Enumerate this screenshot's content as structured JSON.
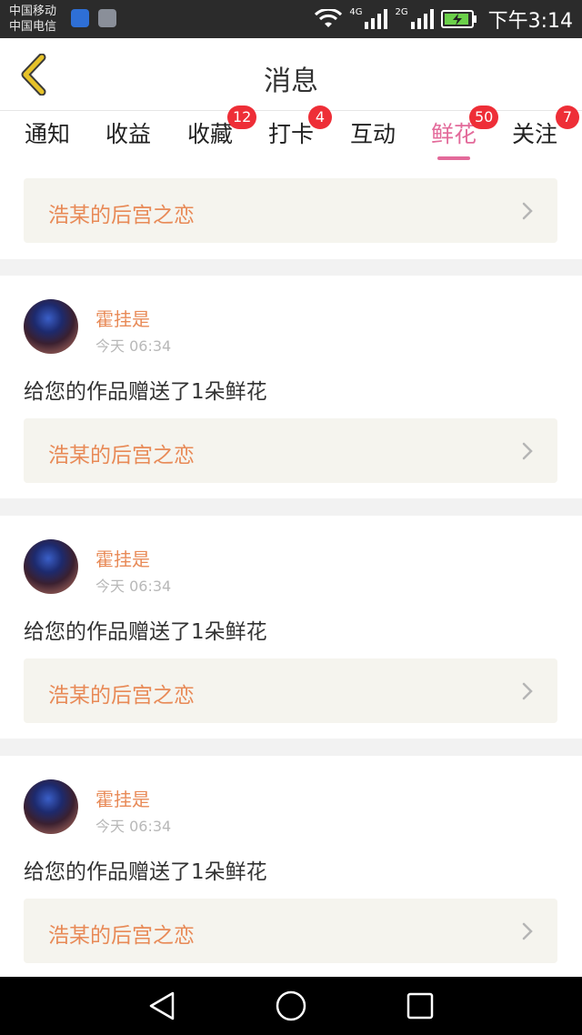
{
  "status_bar": {
    "carrier_1": "中国移动",
    "carrier_2": "中国电信",
    "net_1": "4G",
    "net_2": "2G",
    "time": "下午3:14"
  },
  "header": {
    "title": "消息"
  },
  "tabs": [
    {
      "label": "通知",
      "badge": ""
    },
    {
      "label": "收益",
      "badge": ""
    },
    {
      "label": "收藏",
      "badge": "12"
    },
    {
      "label": "打卡",
      "badge": "4"
    },
    {
      "label": "互动",
      "badge": ""
    },
    {
      "label": "鲜花",
      "badge": "50",
      "active": true
    },
    {
      "label": "关注",
      "badge": "7"
    }
  ],
  "top_partial_card": {
    "work_title": "浩某的后宫之恋"
  },
  "cards": [
    {
      "user": "霍挂是",
      "time": "今天 06:34",
      "message": "给您的作品赠送了1朵鲜花",
      "work_title": "浩某的后宫之恋"
    },
    {
      "user": "霍挂是",
      "time": "今天 06:34",
      "message": "给您的作品赠送了1朵鲜花",
      "work_title": "浩某的后宫之恋"
    },
    {
      "user": "霍挂是",
      "time": "今天 06:34",
      "message": "给您的作品赠送了1朵鲜花",
      "work_title": "浩某的后宫之恋"
    }
  ],
  "colors": {
    "accent_pink": "#e36a9a",
    "accent_orange": "#e88a57",
    "badge_red": "#ee2e37",
    "back_arrow_yellow": "#e6c229"
  },
  "icons": {
    "back": "chevron-left-icon",
    "link_chevron": "chevron-right-icon",
    "nav_back": "triangle-back-icon",
    "nav_home": "circle-home-icon",
    "nav_recents": "square-recents-icon"
  }
}
